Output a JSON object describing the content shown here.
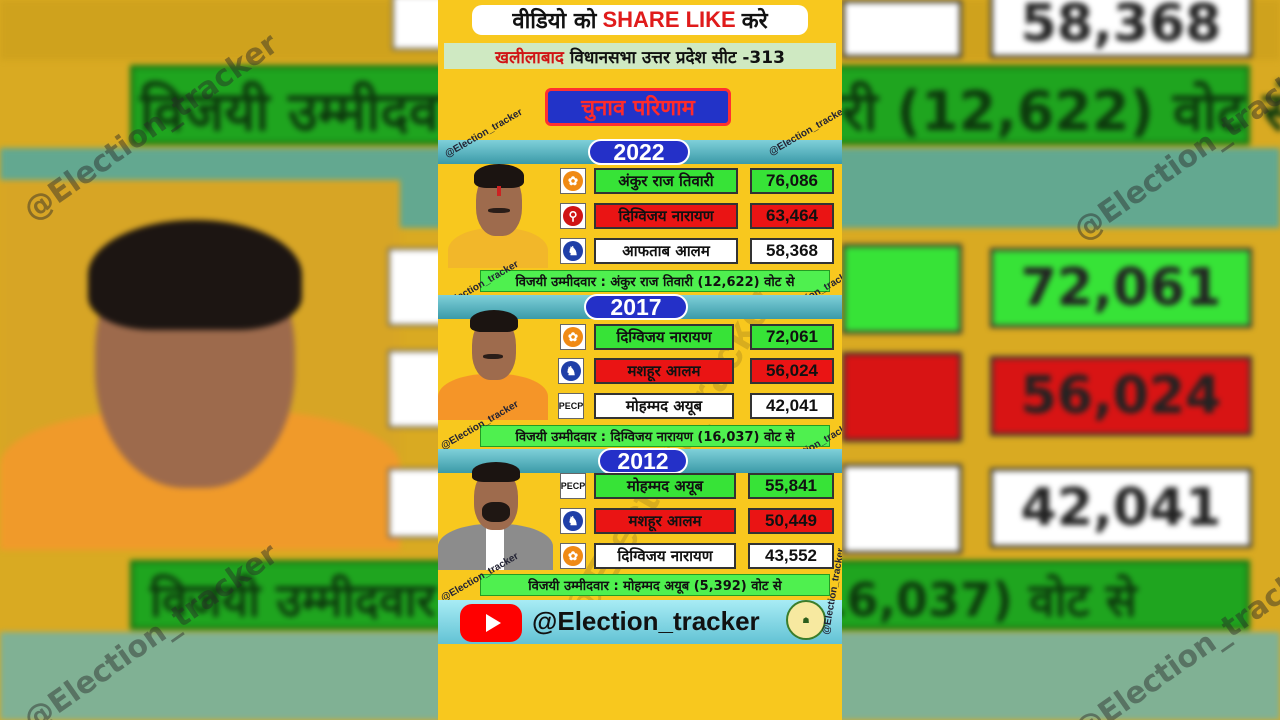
{
  "header": {
    "line1_pre": "वीडियो को",
    "line1_share": "SHARE LIKE",
    "line1_post": "करे",
    "place": "खलीलाबाद",
    "assembly": "विधानसभा उत्तर प्रदेश सीट -313",
    "result_title": "चुनाव परिणाम"
  },
  "watermark": "@Election_tracker",
  "elections": [
    {
      "year": "2022",
      "candidates": [
        {
          "party_logo": "bjp-lotus-icon",
          "name": "अंकुर राज तिवारी",
          "votes": "76,086",
          "status": "green"
        },
        {
          "party_logo": "sp-cycle-icon",
          "name": "दिग्विजय नारायण",
          "votes": "63,464",
          "status": "red"
        },
        {
          "party_logo": "bsp-elephant-icon",
          "name": "आफताब आलम",
          "votes": "58,368",
          "status": "white"
        }
      ],
      "winner_text": "विजयी उम्मीदवार : अंकुर राज तिवारी (12,622) वोट से"
    },
    {
      "year": "2017",
      "candidates": [
        {
          "party_logo": "bjp-lotus-icon",
          "name": "दिग्विजय नारायण",
          "votes": "72,061",
          "status": "green"
        },
        {
          "party_logo": "bsp-elephant-icon",
          "name": "मशहूर आलम",
          "votes": "56,024",
          "status": "red"
        },
        {
          "party_logo": "PECP",
          "name": "मोहम्मद अयूब",
          "votes": "42,041",
          "status": "white"
        }
      ],
      "winner_text": "विजयी उम्मीदवार : दिग्विजय नारायण (16,037) वोट से"
    },
    {
      "year": "2012",
      "candidates": [
        {
          "party_logo": "PECP",
          "name": "मोहम्मद अयूब",
          "votes": "55,841",
          "status": "green"
        },
        {
          "party_logo": "bsp-elephant-icon",
          "name": "मशहूर आलम",
          "votes": "50,449",
          "status": "red"
        },
        {
          "party_logo": "bjp-lotus-icon",
          "name": "दिग्विजय नारायण",
          "votes": "43,552",
          "status": "white"
        }
      ],
      "winner_text": "विजयी उम्मीदवार : मोहम्मद अयूब (5,392) वोट से"
    }
  ],
  "footer": {
    "handle": "@Election_tracker",
    "youtube_icon": "youtube-play-icon"
  },
  "colors": {
    "panel_bg": "#f8c81e",
    "winner_green": "#37e337",
    "runner_red": "#ea1414",
    "year_blue": "#2430c8"
  }
}
